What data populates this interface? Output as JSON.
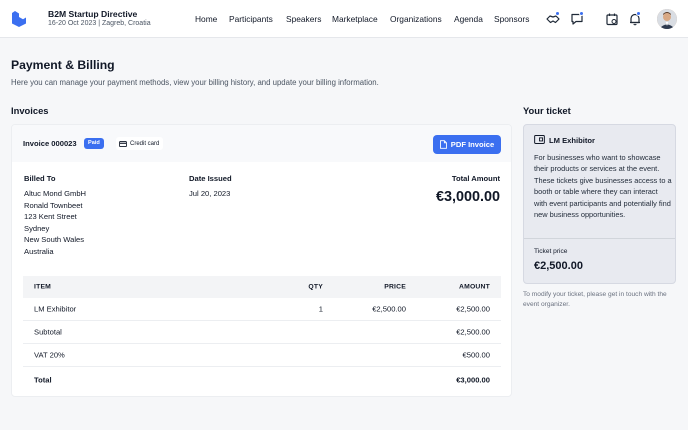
{
  "header": {
    "event_name": "B2M Startup Directive",
    "event_meta": "16-20 Oct 2023 | Zagreb, Croatia",
    "nav": [
      "Home",
      "Participants",
      "Speakers",
      "Marketplace",
      "Organizations",
      "Agenda",
      "Sponsors"
    ],
    "icons": [
      "handshake-icon",
      "chat-icon",
      "calendar-icon",
      "bell-icon"
    ],
    "accent": "#3b6ff0"
  },
  "page": {
    "title": "Payment & Billing",
    "description": "Here you can manage your payment methods, view your billing history, and update your billing information."
  },
  "invoices": {
    "section_title": "Invoices",
    "number": "Invoice 000023",
    "status": "Paid",
    "payment_method": "Credit card",
    "pdf_button": "PDF Invoice",
    "billed_to_label": "Billed To",
    "billed_to": [
      "Altuc Mond GmbH",
      "Ronald Townbeet",
      "123 Kent Street",
      "Sydney",
      "New South Wales",
      "Australia"
    ],
    "date_label": "Date Issued",
    "date_value": "Jul 20, 2023",
    "total_label": "Total Amount",
    "total_value": "€3,000.00",
    "table": {
      "headers": [
        "ITEM",
        "QTY",
        "PRICE",
        "AMOUNT"
      ],
      "item": {
        "name": "LM Exhibitor",
        "qty": "1",
        "price": "€2,500.00",
        "amount": "€2,500.00"
      },
      "subtotal": {
        "label": "Subtotal",
        "amount": "€2,500.00"
      },
      "vat": {
        "label": "VAT 20%",
        "amount": "€500.00"
      },
      "total": {
        "label": "Total",
        "amount": "€3,000.00"
      }
    }
  },
  "ticket": {
    "section_title": "Your ticket",
    "name": "LM Exhibitor",
    "description": "For businesses who want to showcase their products or services at the event. These tickets give businesses access to a booth or table where they can interact with event participants and potentially find new business opportunities.",
    "price_label": "Ticket price",
    "price": "€2,500.00",
    "note": "To modify your ticket, please get in touch with the event organizer."
  }
}
